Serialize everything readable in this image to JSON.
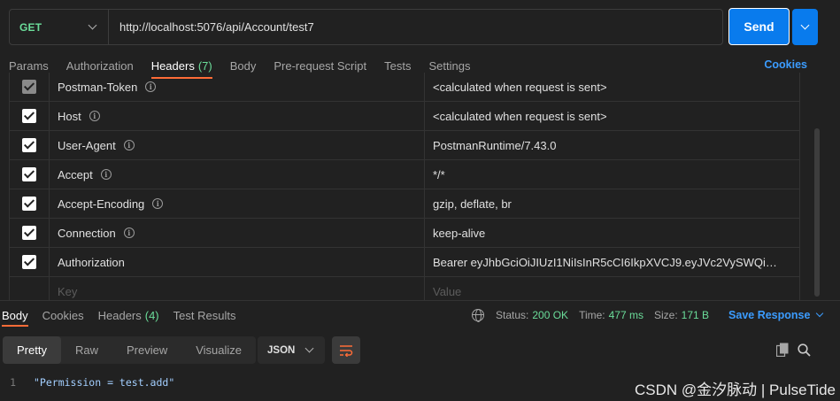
{
  "request": {
    "method": "GET",
    "url": "http://localhost:5076/api/Account/test7",
    "send_label": "Send"
  },
  "request_tabs": [
    {
      "label": "Params"
    },
    {
      "label": "Authorization"
    },
    {
      "label": "Headers",
      "count": "(7)",
      "active": true
    },
    {
      "label": "Body"
    },
    {
      "label": "Pre-request Script"
    },
    {
      "label": "Tests"
    },
    {
      "label": "Settings"
    }
  ],
  "cookies_label": "Cookies",
  "headers": [
    {
      "key": "Postman-Token",
      "value": "<calculated when request is sent>",
      "checked": true,
      "disabled": true,
      "info": true
    },
    {
      "key": "Host",
      "value": "<calculated when request is sent>",
      "checked": true,
      "info": true
    },
    {
      "key": "User-Agent",
      "value": "PostmanRuntime/7.43.0",
      "checked": true,
      "info": true
    },
    {
      "key": "Accept",
      "value": "*/*",
      "checked": true,
      "info": true
    },
    {
      "key": "Accept-Encoding",
      "value": "gzip, deflate, br",
      "checked": true,
      "info": true
    },
    {
      "key": "Connection",
      "value": "keep-alive",
      "checked": true,
      "info": true
    },
    {
      "key": "Authorization",
      "value": "Bearer eyJhbGciOiJIUzI1NiIsInR5cCI6IkpXVCJ9.eyJVc2VySWQiOiIx...",
      "checked": true,
      "info": false
    }
  ],
  "new_row": {
    "key_placeholder": "Key",
    "value_placeholder": "Value"
  },
  "response_tabs": [
    {
      "label": "Body",
      "active": true
    },
    {
      "label": "Cookies"
    },
    {
      "label": "Headers",
      "count": "(4)"
    },
    {
      "label": "Test Results"
    }
  ],
  "status": {
    "status_label": "Status:",
    "status_value": "200 OK",
    "time_label": "Time:",
    "time_value": "477 ms",
    "size_label": "Size:",
    "size_value": "171 B",
    "save_label": "Save Response"
  },
  "view_modes": [
    {
      "label": "Pretty",
      "active": true
    },
    {
      "label": "Raw"
    },
    {
      "label": "Preview"
    },
    {
      "label": "Visualize"
    }
  ],
  "format": "JSON",
  "code_lines": [
    {
      "line": "1",
      "text": "\"Permission = test.add\""
    }
  ],
  "watermark": "CSDN @金汐脉动 | PulseTide",
  "colors": {
    "accent": "#097bed",
    "tab_underline": "#ff6c37",
    "success": "#6bdd9a",
    "link": "#3b9cff",
    "method_get": "#6bdd9a"
  }
}
